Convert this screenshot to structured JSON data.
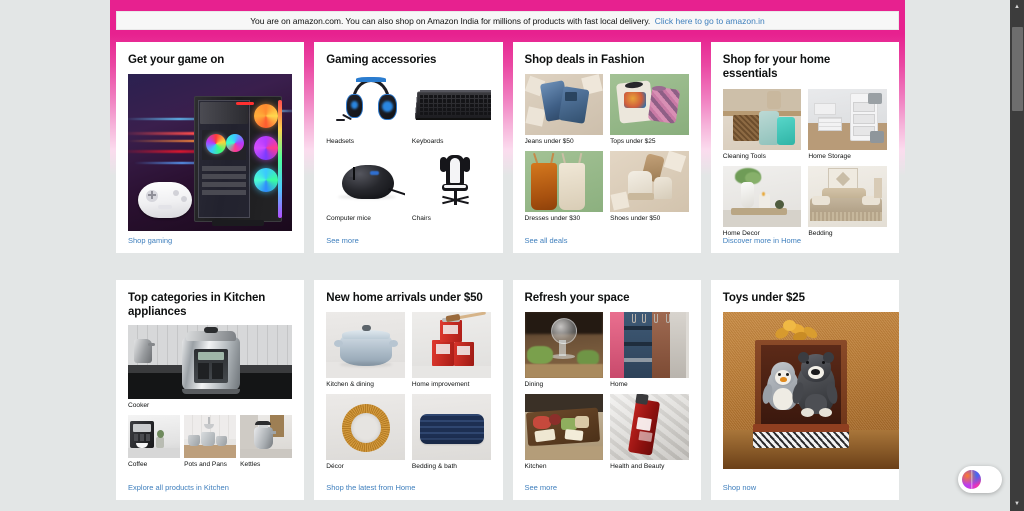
{
  "colors": {
    "brand_pink": "#e7218f",
    "page_background": "#e3e6e6",
    "card_background": "#ffffff",
    "link_blue": "#3f7fbd",
    "text_primary": "#0f1111"
  },
  "banner": {
    "name": "locale-redirect-banner",
    "text": "You are on amazon.com. You can also shop on Amazon India for millions of products with fast local delivery.",
    "link_text": "Click here to go to amazon.in"
  },
  "cards": [
    {
      "id": "get-your-game-on",
      "title": "Get your game on",
      "layout": "hero",
      "link": "Shop gaming",
      "hero_alt": "gaming-pc-and-controller"
    },
    {
      "id": "gaming-accessories",
      "title": "Gaming accessories",
      "layout": "quad-white",
      "link": "See more",
      "tiles": [
        {
          "label": "Headsets",
          "art": "headset"
        },
        {
          "label": "Keyboards",
          "art": "keyboard"
        },
        {
          "label": "Computer mice",
          "art": "mouse"
        },
        {
          "label": "Chairs",
          "art": "chair"
        }
      ]
    },
    {
      "id": "shop-deals-in-fashion",
      "title": "Shop deals in Fashion",
      "layout": "quad",
      "link": "See all deals",
      "tiles": [
        {
          "label": "Jeans under $50",
          "art": "jeans"
        },
        {
          "label": "Tops under $25",
          "art": "tops"
        },
        {
          "label": "Dresses under $30",
          "art": "dresses"
        },
        {
          "label": "Shoes under $50",
          "art": "shoes"
        }
      ]
    },
    {
      "id": "shop-for-your-home-essentials",
      "title": "Shop for your home essentials",
      "layout": "quad",
      "link": "Discover more in Home",
      "tiles": [
        {
          "label": "Cleaning Tools",
          "art": "cleaning"
        },
        {
          "label": "Home Storage",
          "art": "storage"
        },
        {
          "label": "Home Decor",
          "art": "decor"
        },
        {
          "label": "Bedding",
          "art": "bedding"
        }
      ]
    },
    {
      "id": "top-categories-in-kitchen-appliances",
      "title": "Top categories in Kitchen appliances",
      "layout": "hero-plus-three",
      "link": "Explore all products in Kitchen",
      "hero_label": "Cooker",
      "tiles": [
        {
          "label": "Coffee",
          "art": "coffee"
        },
        {
          "label": "Pots and Pans",
          "art": "pots"
        },
        {
          "label": "Kettles",
          "art": "kettle"
        }
      ]
    },
    {
      "id": "new-home-arrivals-under-50",
      "title": "New home arrivals under $50",
      "layout": "quad",
      "link": "Shop the latest from Home",
      "tiles": [
        {
          "label": "Kitchen & dining",
          "art": "dutch-oven"
        },
        {
          "label": "Home improvement",
          "art": "paint-cans"
        },
        {
          "label": "Décor",
          "art": "mirror"
        },
        {
          "label": "Bedding & bath",
          "art": "pillow"
        }
      ]
    },
    {
      "id": "refresh-your-space",
      "title": "Refresh your space",
      "layout": "quad",
      "link": "See more",
      "tiles": [
        {
          "label": "Dining",
          "art": "dining"
        },
        {
          "label": "Home",
          "art": "home-textiles"
        },
        {
          "label": "Kitchen",
          "art": "charcuterie"
        },
        {
          "label": "Health and Beauty",
          "art": "shampoo"
        }
      ]
    },
    {
      "id": "toys-under-25",
      "title": "Toys under $25",
      "layout": "hero",
      "link": "Shop now",
      "hero_alt": "plush-penguin-and-bear-in-gift-box"
    }
  ],
  "assistant_button": {
    "name": "ai-assistant-button",
    "icon": "gradient-orb-icon"
  },
  "scrollbar": {
    "up_icon": "scroll-up-arrow",
    "down_icon": "scroll-down-arrow"
  }
}
